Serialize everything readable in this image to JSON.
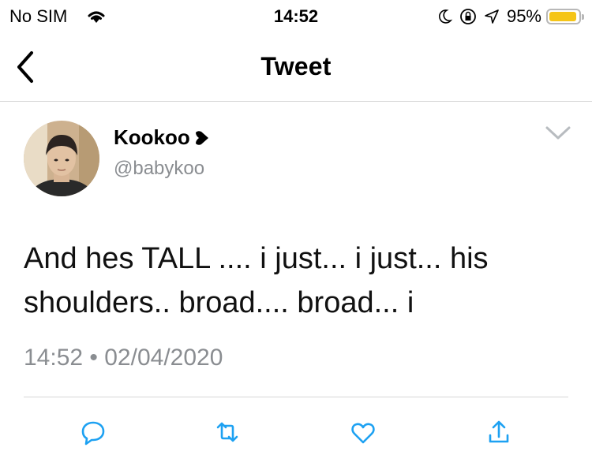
{
  "status_bar": {
    "carrier": "No SIM",
    "time": "14:52",
    "battery_percent": "95%",
    "battery_level": 0.95,
    "battery_color": "#f5c518",
    "icons": [
      "wifi-icon",
      "moon-icon",
      "rotation-lock-icon",
      "location-icon",
      "battery-icon"
    ]
  },
  "nav": {
    "title": "Tweet",
    "back_icon": "chevron-left-icon"
  },
  "tweet": {
    "author_name": "Kookoo",
    "name_emoji_icon": "heart-icon",
    "author_handle": "@babykoo",
    "text_line_1": "And hes TALL .... i just... i just... his",
    "text_line_2": "shoulders.. broad.... broad... i",
    "timestamp": "14:52 • 02/04/2020",
    "menu_icon": "chevron-down-icon"
  },
  "actions": {
    "icons": [
      "reply-icon",
      "retweet-icon",
      "like-icon",
      "share-icon"
    ],
    "icon_color": "#1da1f2"
  }
}
